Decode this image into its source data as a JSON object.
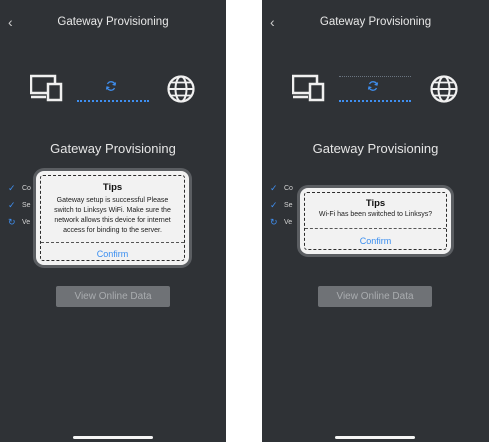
{
  "screens": [
    {
      "header_title": "Gateway Provisioning",
      "back_icon": "chevron-left-icon",
      "main_title": "Gateway Provisioning",
      "steps": [
        {
          "icon": "check-icon",
          "label": "Co"
        },
        {
          "icon": "check-icon",
          "label": "Se"
        },
        {
          "icon": "sync-icon",
          "label": "Ve"
        }
      ],
      "view_button": "View Online Data",
      "dialog": {
        "title": "Tips",
        "message": "Gateway setup is successful Please switch to Linksys WiFi. Make sure the network allows this device for internet access for binding to the server.",
        "confirm": "Confirm"
      }
    },
    {
      "header_title": "Gateway Provisioning",
      "back_icon": "chevron-left-icon",
      "main_title": "Gateway Provisioning",
      "steps": [
        {
          "icon": "check-icon",
          "label": "Co"
        },
        {
          "icon": "check-icon",
          "label": "Se"
        },
        {
          "icon": "sync-icon",
          "label": "Ve"
        }
      ],
      "view_button": "View Online Data",
      "dialog": {
        "title": "Tips",
        "message": "Wi-Fi has been switched to Linksys?",
        "confirm": "Confirm"
      }
    }
  ],
  "colors": {
    "background": "#2f3236",
    "accent": "#3f8ff0",
    "dialog": "#f2f2f2",
    "button_disabled": "#6f7276"
  }
}
